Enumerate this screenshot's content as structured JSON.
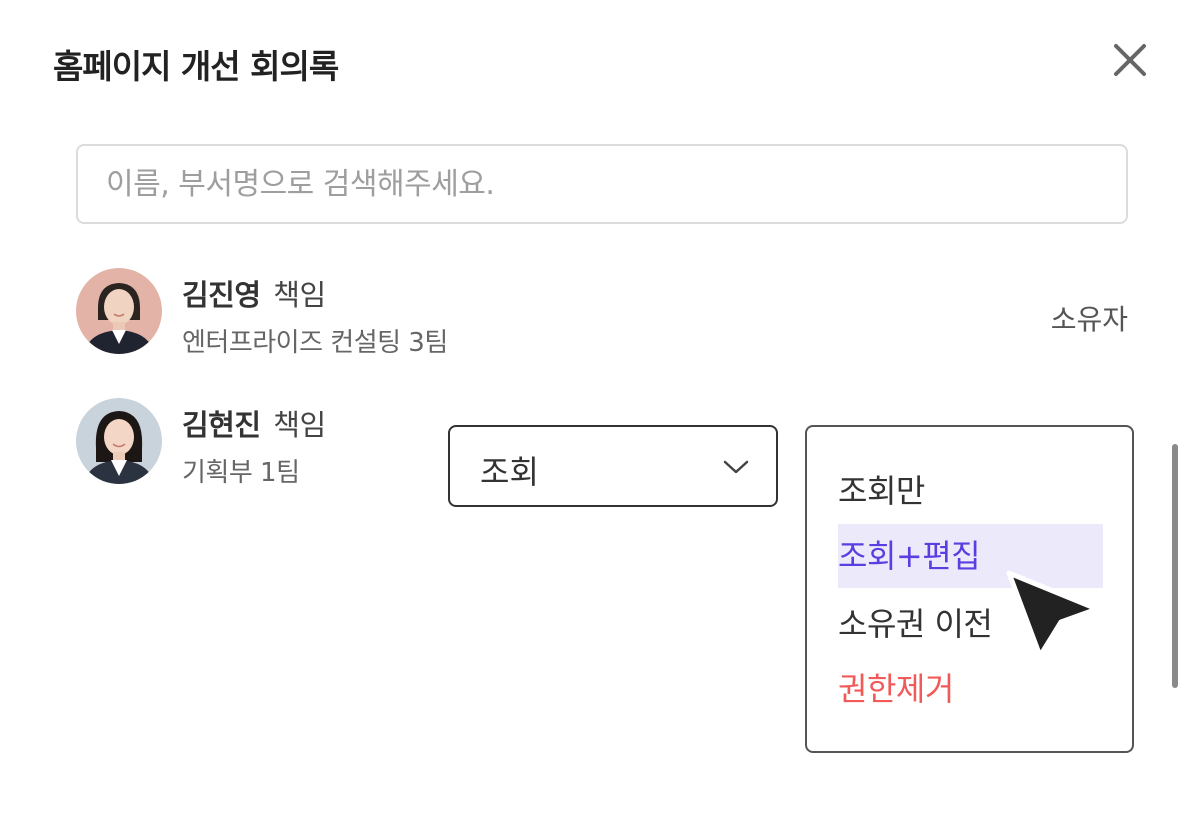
{
  "dialog": {
    "title": "홈페이지 개선 회의록",
    "close_icon": "close-icon"
  },
  "search": {
    "placeholder": "이름, 부서명으로 검색해주세요.",
    "value": ""
  },
  "members": [
    {
      "name": "김진영",
      "title": "책임",
      "department": "엔터프라이즈 컨설팅 3팀",
      "role": "소유자",
      "avatar_bg": "#e2b3a6"
    },
    {
      "name": "김현진",
      "title": "책임",
      "department": "기획부 1팀",
      "avatar_bg": "#c9d3db"
    }
  ],
  "permission_select": {
    "value": "조회",
    "icon": "chevron-down-icon"
  },
  "dropdown": {
    "items": [
      {
        "label": "조회만"
      },
      {
        "label": "조회+편집",
        "state": "hovered"
      },
      {
        "label": "소유권 이전"
      },
      {
        "label": "권한제거"
      }
    ]
  },
  "colors": {
    "highlight_bg": "#ece9fb",
    "highlight_text": "#5b3ee0",
    "danger_text": "#f25a5a",
    "border": "#dcdcdc"
  }
}
